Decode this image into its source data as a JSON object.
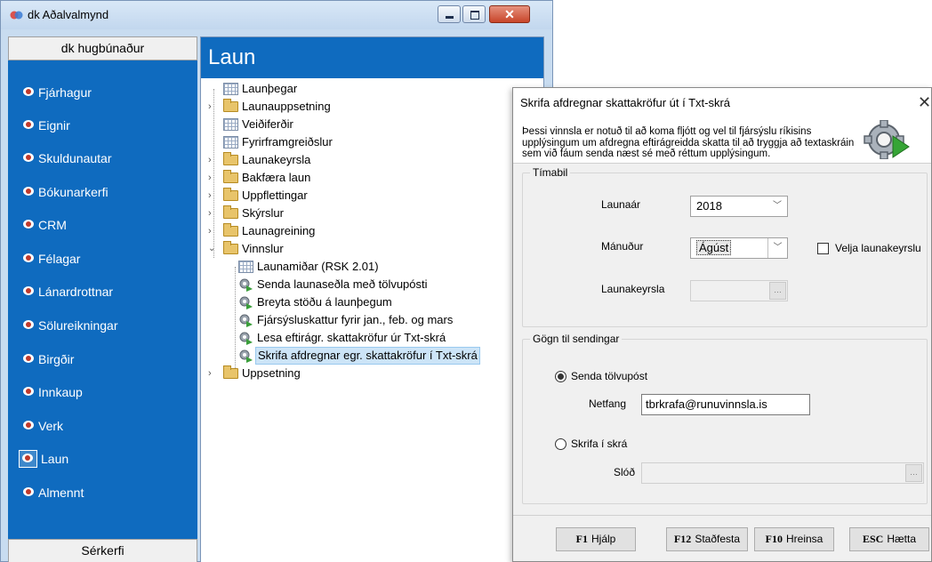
{
  "main_window": {
    "title": "dk Aðalvalmynd"
  },
  "sidebar": {
    "header": "dk hugbúnaður",
    "footer": "Sérkerfi",
    "items": [
      {
        "label": "Fjárhagur"
      },
      {
        "label": "Eignir"
      },
      {
        "label": "Skuldunautar"
      },
      {
        "label": "Bókunarkerfi"
      },
      {
        "label": "CRM"
      },
      {
        "label": "Félagar"
      },
      {
        "label": "Lánardrottnar"
      },
      {
        "label": "Sölureikningar"
      },
      {
        "label": "Birgðir"
      },
      {
        "label": "Innkaup"
      },
      {
        "label": "Verk"
      },
      {
        "label": "Laun"
      },
      {
        "label": "Almennt"
      }
    ],
    "active_item": "Laun"
  },
  "panel": {
    "title": "Laun",
    "tree": [
      {
        "label": "Launþegar",
        "icon": "grid-icon"
      },
      {
        "label": "Launauppsetning",
        "icon": "folder-icon",
        "expandable": true
      },
      {
        "label": "Veiðiferðir",
        "icon": "grid-icon"
      },
      {
        "label": "Fyrirframgreiðslur",
        "icon": "grid-icon"
      },
      {
        "label": "Launakeyrsla",
        "icon": "folder-icon",
        "expandable": true
      },
      {
        "label": "Bakfæra laun",
        "icon": "folder-icon",
        "expandable": true
      },
      {
        "label": "Uppflettingar",
        "icon": "folder-icon",
        "expandable": true
      },
      {
        "label": "Skýrslur",
        "icon": "folder-icon",
        "expandable": true
      },
      {
        "label": "Launagreining",
        "icon": "folder-icon",
        "expandable": true
      },
      {
        "label": "Vinnslur",
        "icon": "folder-icon",
        "expanded": true,
        "children": [
          {
            "label": "Launamiðar (RSK 2.01)",
            "icon": "grid-icon"
          },
          {
            "label": "Senda launaseðla með tölvupósti",
            "icon": "gear-icon"
          },
          {
            "label": "Breyta stöðu á launþegum",
            "icon": "gear-icon"
          },
          {
            "label": "Fjársýsluskattur fyrir jan., feb. og mars",
            "icon": "gear-icon"
          },
          {
            "label": "Lesa eftirágr. skattakröfur úr Txt-skrá",
            "icon": "gear-icon"
          },
          {
            "label": "Skrifa afdregnar egr. skattakröfur í Txt-skrá",
            "icon": "gear-icon",
            "selected": true
          }
        ]
      },
      {
        "label": "Uppsetning",
        "icon": "folder-icon",
        "expandable": true
      }
    ]
  },
  "dialog": {
    "title": "Skrifa afdregnar skattakröfur út í Txt-skrá",
    "close_glyph": "✕",
    "description": "Þessi vinnsla er notuð til að koma fljótt og vel til fjársýslu ríkisins upplýsingum um afdregna eftirágreidda skatta til að tryggja að textaskráin sem við fáum senda næst sé með réttum upplýsingum.",
    "period_group": {
      "title": "Tímabil",
      "year_label": "Launaár",
      "year_value": "2018",
      "month_label": "Mánuður",
      "month_value": "Ágúst",
      "select_runs_label": "Velja launakeyrslu",
      "select_runs_checked": false,
      "run_label": "Launakeyrsla",
      "run_value": ""
    },
    "send_group": {
      "title": "Gögn til sendingar",
      "email_option_label": "Senda tölvupóst",
      "email_option_checked": true,
      "email_label": "Netfang",
      "email_value": "tbrkrafa@runuvinnsla.is",
      "file_option_label": "Skrifa í skrá",
      "file_option_checked": false,
      "path_label": "Slóð",
      "path_value": ""
    },
    "buttons": [
      {
        "key": "F1",
        "label": "Hjálp"
      },
      {
        "key": "F12",
        "label": "Staðfesta"
      },
      {
        "key": "F10",
        "label": "Hreinsa"
      },
      {
        "key": "ESC",
        "label": "Hætta"
      }
    ]
  },
  "colors": {
    "sidebar_blue": "#0f6bbf",
    "selection": "#cce4f7",
    "close_red": "#c8452a"
  }
}
